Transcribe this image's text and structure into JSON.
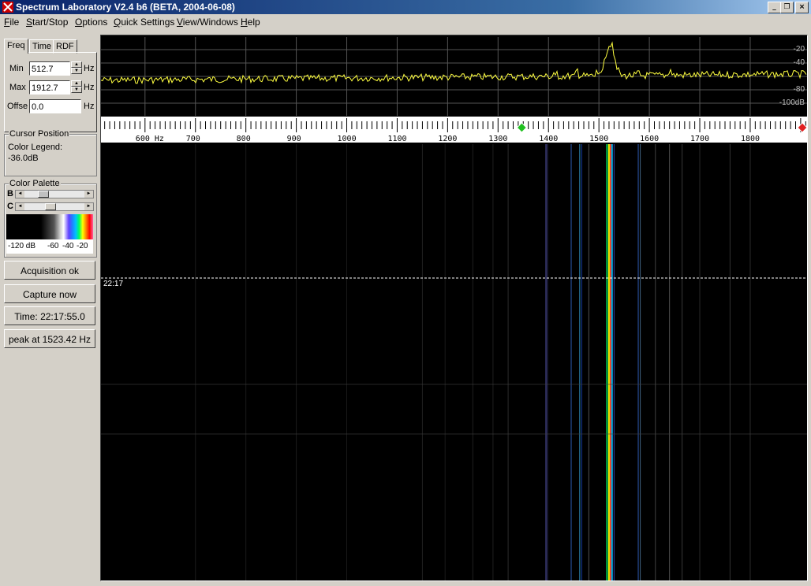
{
  "window": {
    "title": "Spectrum Laboratory V2.4 b6 (BETA,  2004-06-08)",
    "minimize_glyph": "_",
    "maximize_glyph": "❐",
    "close_glyph": "×"
  },
  "menu": [
    {
      "label": "File",
      "mnemonic": "F",
      "rest": "ile"
    },
    {
      "label": "Start/Stop",
      "mnemonic": "S",
      "rest": "tart/Stop"
    },
    {
      "label": "Options",
      "mnemonic": "O",
      "rest": "ptions"
    },
    {
      "label": "Quick Settings",
      "mnemonic": "Q",
      "rest": "uick Settings"
    },
    {
      "label": "View/Windows",
      "mnemonic": "V",
      "rest": "iew/Windows"
    },
    {
      "label": "Help",
      "mnemonic": "H",
      "rest": "elp"
    }
  ],
  "tabs": {
    "freq": "Freq",
    "time": "Time",
    "rdf": "RDF"
  },
  "freq_panel": {
    "min_label": "Min",
    "min_value": "512.7",
    "min_unit": "Hz",
    "max_label": "Max",
    "max_value": "1912.7",
    "max_unit": "Hz",
    "offset_label": "Offse",
    "offset_value": "0.0",
    "offset_unit": "Hz"
  },
  "cursor_position": {
    "title": "Cursor Position",
    "legend_label": "Color Legend:",
    "legend_value": "-36.0dB"
  },
  "color_palette": {
    "title": "Color Palette",
    "b_label": "B",
    "c_label": "C",
    "b_level": 0.28,
    "c_level": 0.42,
    "scale_labels": [
      "-120 dB",
      "-60",
      "-40",
      "-20"
    ]
  },
  "buttons": {
    "acquisition": "Acquisition ok",
    "capture": "Capture now",
    "time": "Time:  22:17:55.0",
    "peak": "peak at 1523.42 Hz"
  },
  "spectrum": {
    "db_labels": [
      "-20",
      "-40",
      "-80",
      "-100dB"
    ],
    "x_min_hz": 512.7,
    "x_max_hz": 1912.7,
    "grid_freqs": [
      600,
      700,
      800,
      900,
      1000,
      1100,
      1200,
      1300,
      1400,
      1500,
      1600,
      1700,
      1800
    ],
    "trace_color": "#ffff40"
  },
  "scale": {
    "labels": [
      "600 Hz",
      "700",
      "800",
      "900",
      "1000",
      "1100",
      "1200",
      "1300",
      "1400",
      "1500",
      "1600",
      "1700",
      "1800"
    ],
    "green_marker_hz": 1347,
    "red_marker_hz": 1912
  },
  "waterfall": {
    "time_label": "22:17",
    "main_line_hz": 1523
  }
}
